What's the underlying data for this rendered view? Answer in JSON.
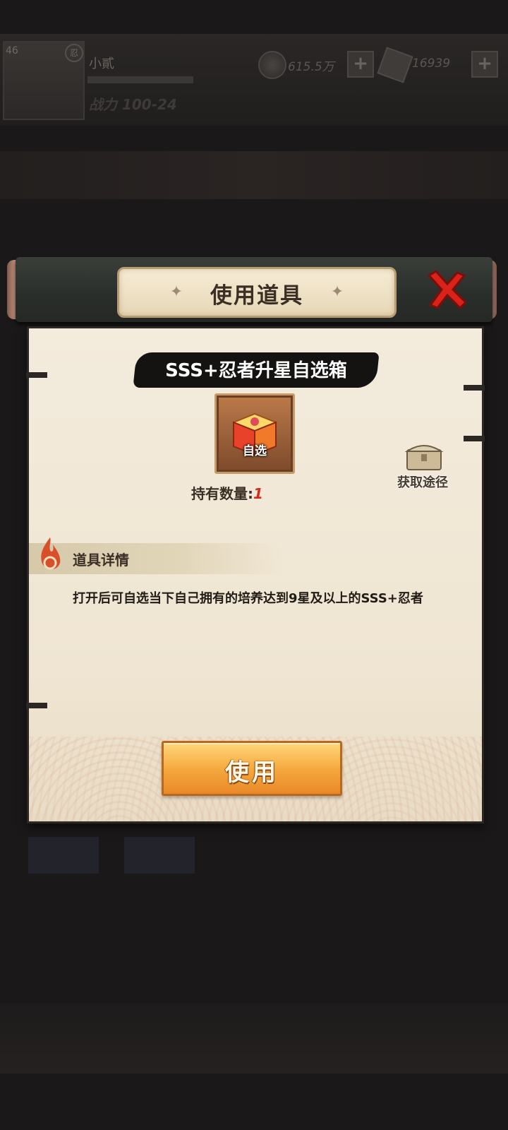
{
  "hud": {
    "avatar_level": "46",
    "avatar_badge": "忍",
    "player_name": "小貳",
    "power": "战力 100-24",
    "coins": "615.5万",
    "gems": "16939",
    "plus": "+"
  },
  "dialog": {
    "title": "使用道具",
    "item_name": "SSS+忍者升星自选箱",
    "item_tag": "自选",
    "quantity_label": "持有数量:",
    "quantity_value": "1",
    "source_label": "获取途径",
    "detail_title": "道具详情",
    "detail_text": "打开后可自选当下自己拥有的培养达到9星及以上的SSS+忍者",
    "use_button": "使用"
  },
  "colors": {
    "accent_gold": "#f4a63b",
    "close_red": "#d8221a",
    "quantity_red": "#d12c1c",
    "panel_bg": "#f3ebdc"
  }
}
